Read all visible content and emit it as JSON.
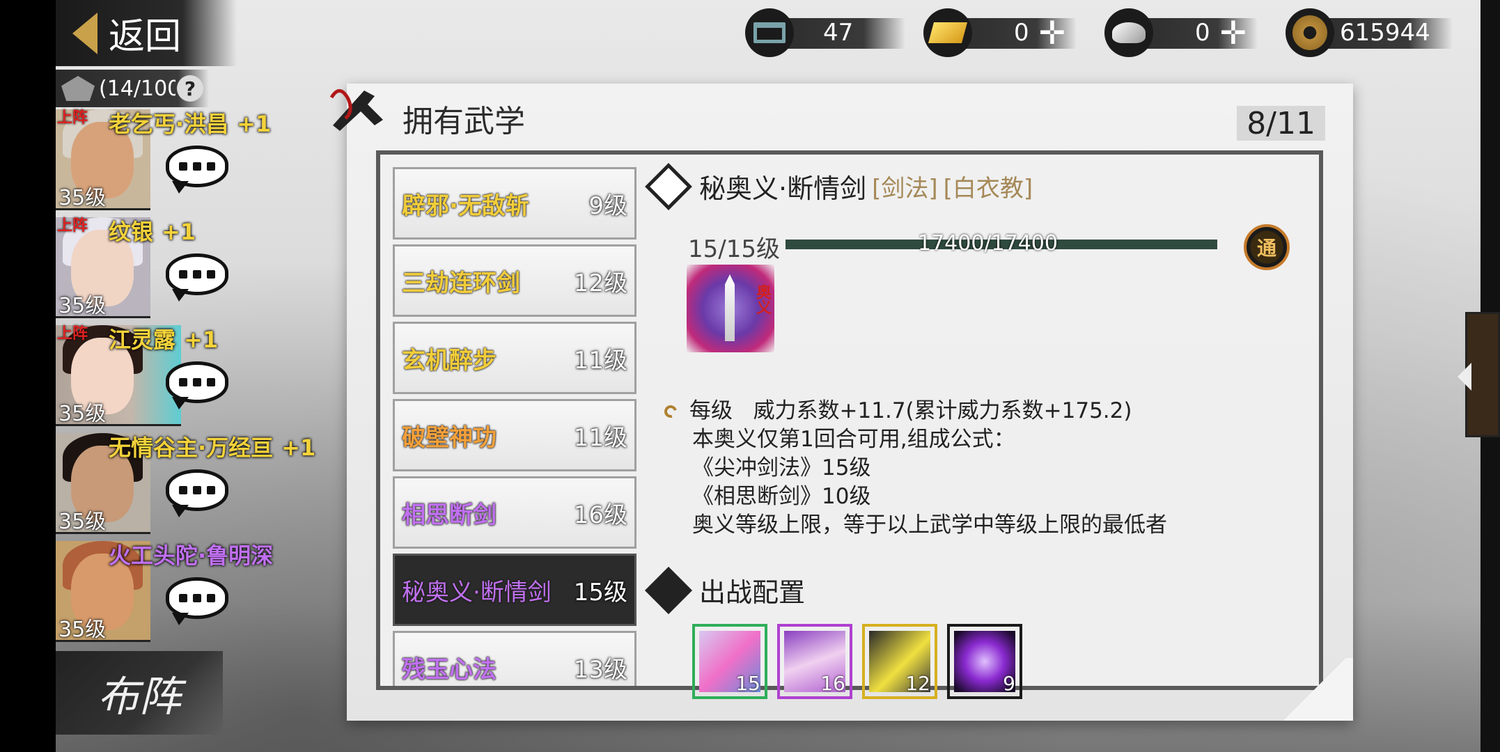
{
  "header": {
    "back_label": "返回",
    "capacity_text": "(14/100",
    "help_glyph": "?"
  },
  "currencies": [
    {
      "icon": "cart-icon",
      "value": "47",
      "has_add": false
    },
    {
      "icon": "gold-ingot-icon",
      "value": "0",
      "has_add": true
    },
    {
      "icon": "silver-ingot-icon",
      "value": "0",
      "has_add": true
    },
    {
      "icon": "copper-coin-icon",
      "value": "615944",
      "has_add": false
    }
  ],
  "characters": [
    {
      "name": "老乞丐·洪昌",
      "bonus": "+1",
      "level": "35级",
      "deployed": "上阵",
      "name_color": "#f3d23a"
    },
    {
      "name": "纹银",
      "bonus": "+1",
      "level": "35级",
      "deployed": "上阵",
      "name_color": "#f3d23a"
    },
    {
      "name": "江灵露",
      "bonus": "+1",
      "level": "35级",
      "deployed": "上阵",
      "name_color": "#f3d23a"
    },
    {
      "name": "无情谷主·万经亘",
      "bonus": "+1",
      "level": "35级",
      "deployed": "",
      "name_color": "#f3d23a"
    },
    {
      "name": "火工头陀·鲁明深",
      "bonus": "",
      "level": "35级",
      "deployed": "",
      "name_color": "#c070f0"
    }
  ],
  "formation_label": "布阵",
  "panel": {
    "title": "拥有武学",
    "count": "8/11"
  },
  "skills": [
    {
      "name": "辟邪·无敌斩",
      "level": "9级",
      "color": "gold",
      "selected": false
    },
    {
      "name": "三劫连环剑",
      "level": "12级",
      "color": "gold",
      "selected": false
    },
    {
      "name": "玄机醉步",
      "level": "11级",
      "color": "gold",
      "selected": false
    },
    {
      "name": "破壁神功",
      "level": "11级",
      "color": "orange",
      "selected": false
    },
    {
      "name": "相思断剑",
      "level": "16级",
      "color": "purple",
      "selected": false
    },
    {
      "name": "秘奥义·断情剑",
      "level": "15级",
      "color": "purple",
      "selected": true
    },
    {
      "name": "残玉心法",
      "level": "13级",
      "color": "purple",
      "selected": false
    }
  ],
  "detail": {
    "name": "秘奥义·断情剑",
    "tag1": "[剑法]",
    "tag2": "[白衣教]",
    "level_text": "15/15级",
    "exp_text": "17400/17400",
    "exp_progress": 1.0,
    "tong_glyph": "通",
    "icon_badge": "奥义",
    "desc": {
      "line1_label": "每级",
      "line1_value": "威力系数+11.7(累计威力系数+175.2)",
      "line2": "本奥义仅第1回合可用,组成公式：",
      "line3": "《尖冲剑法》15级",
      "line4": "《相思断剑》10级",
      "line5": "奥义等级上限，等于以上武学中等级上限的最低者"
    }
  },
  "deploy": {
    "label": "出战配置",
    "slots": [
      {
        "level": "15",
        "border": "#2fae5a"
      },
      {
        "level": "16",
        "border": "#b040d0"
      },
      {
        "level": "12",
        "border": "#d6b020"
      },
      {
        "level": "9",
        "border": "#1a1a1a"
      }
    ]
  }
}
